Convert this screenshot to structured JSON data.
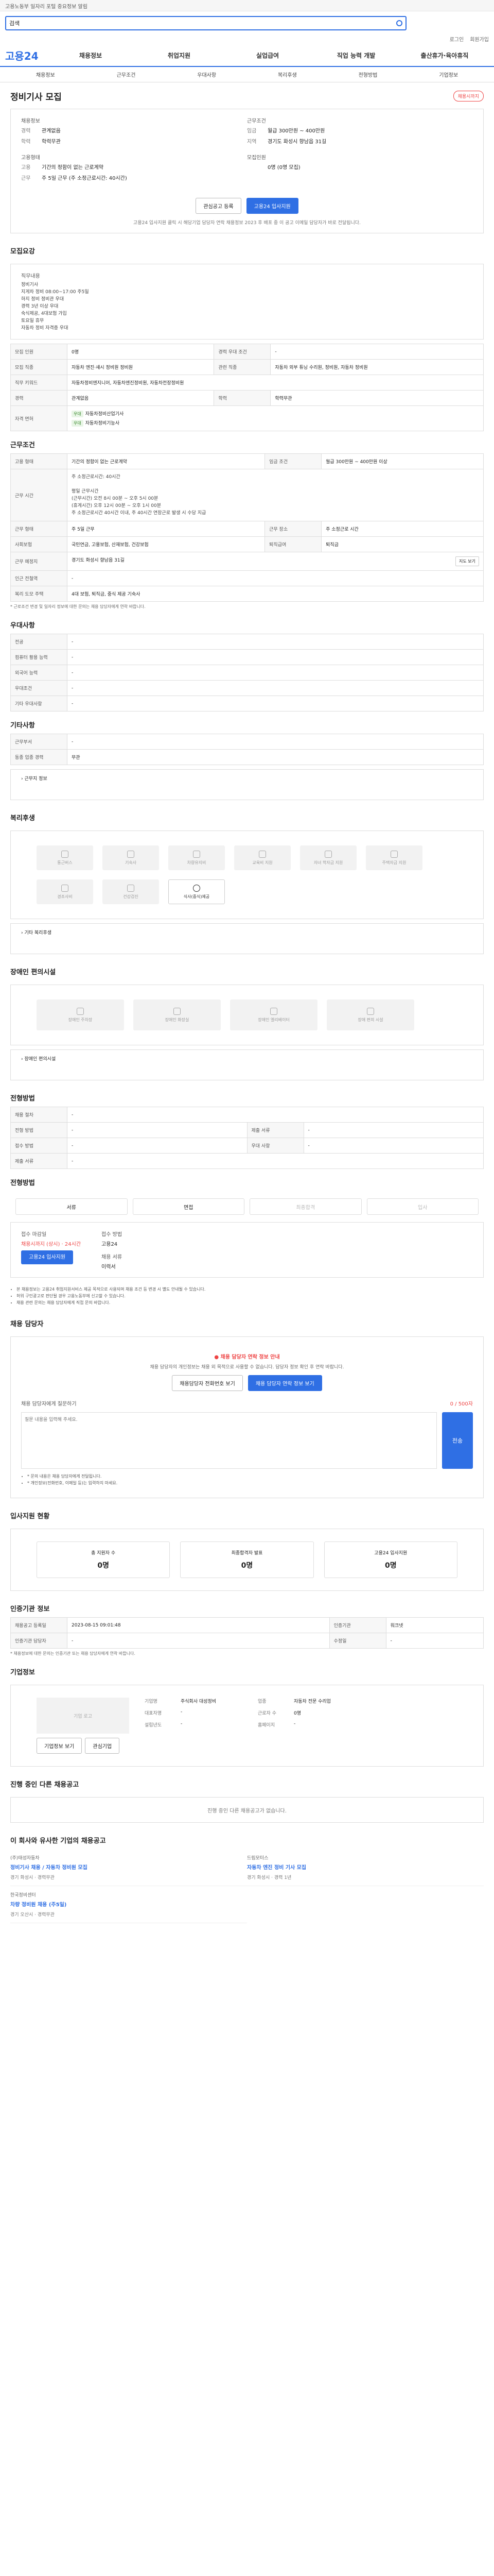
{
  "topbar": {
    "text": "고용노동부 일자리 포털 중요정보 알림"
  },
  "search": {
    "placeholder": "검색"
  },
  "util": [
    "로그인",
    "회원가입"
  ],
  "logo": "고용24",
  "gnb": [
    "채용정보",
    "취업지원",
    "실업급여",
    "직업 능력 개발",
    "출산휴가·육아휴직"
  ],
  "tabs": [
    "채용정보",
    "근무조건",
    "우대사항",
    "복리후생",
    "전형방법",
    "기업정보"
  ],
  "job": {
    "title": "정비기사 모집",
    "badge": "채용시까지",
    "sum_left_title": "채용정보",
    "sum_left": [
      {
        "k": "경력",
        "v": "관계없음"
      },
      {
        "k": "학력",
        "v": "학력무관"
      }
    ],
    "sum_left_title2": "고용형태",
    "sum_left2": [
      {
        "k": "고용",
        "v": "기간의 정함이 없는 근로계약"
      },
      {
        "k": "근무",
        "v": "주 5일 근무 (주 소정근로시간: 40시간)"
      }
    ],
    "sum_right_title": "근무조건",
    "sum_right": [
      {
        "k": "임금",
        "v": "월급 300만원 ~ 400만원"
      },
      {
        "k": "지역",
        "v": "경기도 화성시 향남읍 31길"
      }
    ],
    "sum_right_title2": "모집인원",
    "sum_right2": [
      {
        "k": "",
        "v": "0명 (0명 모집)"
      }
    ],
    "btn_scrap": "관심공고 등록",
    "btn_apply": "고용24 입사지원",
    "note": "고용24 입사지원 클릭 시 해당기업 담당자 연락 채용정보 2023 후 배포 중 이 공고 이메일 담당자가 바로 전달됩니다."
  },
  "recruit": {
    "heading": "모집요강",
    "body_title": "직무내용",
    "body": "정비기사\n지게차 정비 08:00~17:00 주5일\n하지 정비 정비관 우대\n경력 3년 이상 우대\n숙식제공, 4대보험 가입\n토요일 휴무\n자동차 정비 자격증 우대",
    "rows": [
      [
        "모집 인원",
        "0명",
        "경력 우대 조건",
        "-"
      ],
      [
        "모집 직종",
        "자동차 엔진·섀시 정비원 정비원",
        "관련 직종",
        "자동차 외부 튜닝 수리원, 정비원, 자동차 정비원"
      ],
      [
        "직무 키워드",
        "자동차정비엔지니어, 자동차엔진정비원, 자동차전장정비원",
        "",
        ""
      ],
      [
        "경력",
        "관계없음",
        "학력",
        "학력무관"
      ]
    ],
    "license_label": "자격 면허",
    "licenses": [
      {
        "tag": "우대",
        "v": "자동차정비산업기사"
      },
      {
        "tag": "우대",
        "v": "자동차정비기능사"
      }
    ]
  },
  "work": {
    "heading": "근무조건",
    "rows": [
      [
        "고용 형태",
        "기간의 정함이 없는 근로계약",
        "임금 조건",
        "월급 300만원 ~ 400만원 이상"
      ],
      [
        "근무 시간",
        "08:00 ~ 17:00 (평일) / 주 5일 근무",
        "",
        ""
      ],
      [
        "근무 형태",
        "주 5일 근무",
        "근무 장소",
        "주 소정근로 시간"
      ],
      [
        "사회보험",
        "국민연금, 고용보험, 산재보험, 건강보험",
        "퇴직급여",
        "퇴직금"
      ],
      [
        "근무 예정지",
        "경기도 화성시 향남읍 31길",
        "",
        ""
      ],
      [
        "인근 전철역",
        "-",
        "",
        ""
      ],
      [
        "복리 도모 주택",
        "4대 보험, 퇴직금, 중식 제공 기숙사",
        "",
        ""
      ]
    ],
    "hours_detail": "주 소정근로시간: 40시간\n\n평일 근무시간\n(근무시간) 오전 8시 00분 ~ 오후 5시 00분\n(휴게시간) 오후 12시 00분 ~ 오후 1시 00분\n주 소정근로시간 40시간 이내, 주 40시간 연장근로 발생 시 수당 지급",
    "map_btn": "지도 보기",
    "footnote": "* 근로조건 변경 및 일자리 정보에 대한 문의는 채용 담당자에게 연락 바랍니다."
  },
  "prefer": {
    "heading": "우대사항",
    "rows": [
      [
        "전공",
        "-"
      ],
      [
        "컴퓨터 활용 능력",
        "-"
      ],
      [
        "외국어 능력",
        "-"
      ],
      [
        "우대조건",
        "-"
      ],
      [
        "기타 우대사항",
        "-"
      ]
    ]
  },
  "etc": {
    "heading": "기타사항",
    "rows": [
      [
        "근무부서",
        "-"
      ],
      [
        "동종 업종 경력",
        "무관"
      ]
    ],
    "link": "근무지 정보"
  },
  "welfare": {
    "heading": "복리후생",
    "items": [
      "통근버스",
      "기숙사",
      "차량유지비",
      "교육비 지원",
      "자녀 학자금 지원",
      "주택자금 지원",
      "경조사비",
      "건강검진",
      "식사(중식)제공"
    ],
    "active_index": 8,
    "link": "기타 복리후생"
  },
  "disabled": {
    "heading": "장애인 편의시설",
    "items": [
      "장애인 주차장",
      "장애인 화장실",
      "장애인 엘리베이터",
      "장애 편의 시설"
    ],
    "link": "장애인 편의시설"
  },
  "process": {
    "heading": "전형방법",
    "rows": [
      [
        "채용 절차",
        "-"
      ],
      [
        "전형 방법",
        "-"
      ],
      [
        "접수 방법",
        "-"
      ],
      [
        "제출 서류",
        "-"
      ]
    ],
    "rows_right": [
      [
        "제출 서류",
        "-"
      ],
      [
        "우대 사항",
        "-"
      ]
    ]
  },
  "apply": {
    "heading": "전형방법",
    "steps": [
      "서류",
      "면접",
      "최종합격",
      "입사"
    ],
    "method_title": "접수 마감일",
    "method_val": "채용시까지 (상시) · 24시간",
    "method2_title": "접수 방법",
    "method2_val": "고용24",
    "method3_title": "채용 서류",
    "method3_val": "이력서",
    "btn_apply": "고용24 입사지원",
    "notes": [
      "본 채용정보는 고용24 취업지원서비스 제공 목적으로 사용되며 채용 조건 등 변경 시 별도 안내될 수 있습니다.",
      "허위 구인광고로 판단될 경우 고용노동부에 신고할 수 있습니다.",
      "채용 관련 문의는 채용 담당자에게 직접 문의 바랍니다."
    ]
  },
  "contact": {
    "heading": "채용 담당자",
    "warn": "채용 담당자 연락 정보 안내",
    "desc": "채용 담당자의 개인정보는 채용 외 목적으로 사용할 수 없습니다. 담당자 정보 확인 후 연락 바랍니다.",
    "btn1": "채용담당자 전화번호 보기",
    "btn2": "채용 담당자 연락 정보 보기",
    "qa_title": "채용 담당자에게 질문하기",
    "qa_counter": "0 / 500자",
    "qa_placeholder": "질문 내용을 입력해 주세요.",
    "qa_send": "전송",
    "qa_notes": [
      "* 문의 내용은 채용 담당자에게 전달됩니다.",
      "* 개인정보(전화번호, 이메일 등)는 입력하지 마세요."
    ]
  },
  "stats": {
    "heading": "입사지원 현황",
    "items": [
      {
        "t": "총 지원자 수",
        "v": "0명"
      },
      {
        "t": "최종합격자 발표",
        "v": "0명"
      },
      {
        "t": "고용24 입사지원",
        "v": "0명"
      }
    ]
  },
  "meta": {
    "heading": "인증기관 정보",
    "rows": [
      [
        "채용공고 등록일",
        "2023-08-15 09:01:48",
        "인증기관",
        "워크넷"
      ],
      [
        "인증기관 담당자",
        "-",
        "수정일",
        "-"
      ]
    ],
    "notes": [
      "* 채용정보에 대한 문의는 인증기관 또는 채용 담당자에게 연락 바랍니다."
    ]
  },
  "company": {
    "heading": "기업정보",
    "logo_alt": "기업 로고",
    "fields": [
      [
        "기업명",
        "주식회사 대성정비"
      ],
      [
        "업종",
        "자동차 전문 수리업"
      ],
      [
        "대표자명",
        "-"
      ],
      [
        "근로자 수",
        "0명"
      ],
      [
        "설립년도",
        "-"
      ],
      [
        "홈페이지",
        "-"
      ]
    ],
    "btn_more": "기업정보 보기",
    "btn_fav": "관심기업"
  },
  "related": {
    "heading": "진행 중인 다른 채용공고",
    "empty": "진행 중인 다른 채용공고가 없습니다."
  },
  "similar": {
    "heading": "이 회사와 유사한 기업의 채용공고",
    "cards": [
      {
        "co": "(주)태성자동차",
        "title": "정비기사 채용 / 자동차 정비원 모집",
        "meta": "경기 화성시 · 경력무관"
      },
      {
        "co": "드림모터스",
        "title": "자동차 엔진 정비 기사 모집",
        "meta": "경기 화성시 · 경력 1년"
      },
      {
        "co": "한국정비센터",
        "title": "차량 정비원 채용 (주5일)",
        "meta": "경기 오산시 · 경력무관"
      }
    ]
  }
}
